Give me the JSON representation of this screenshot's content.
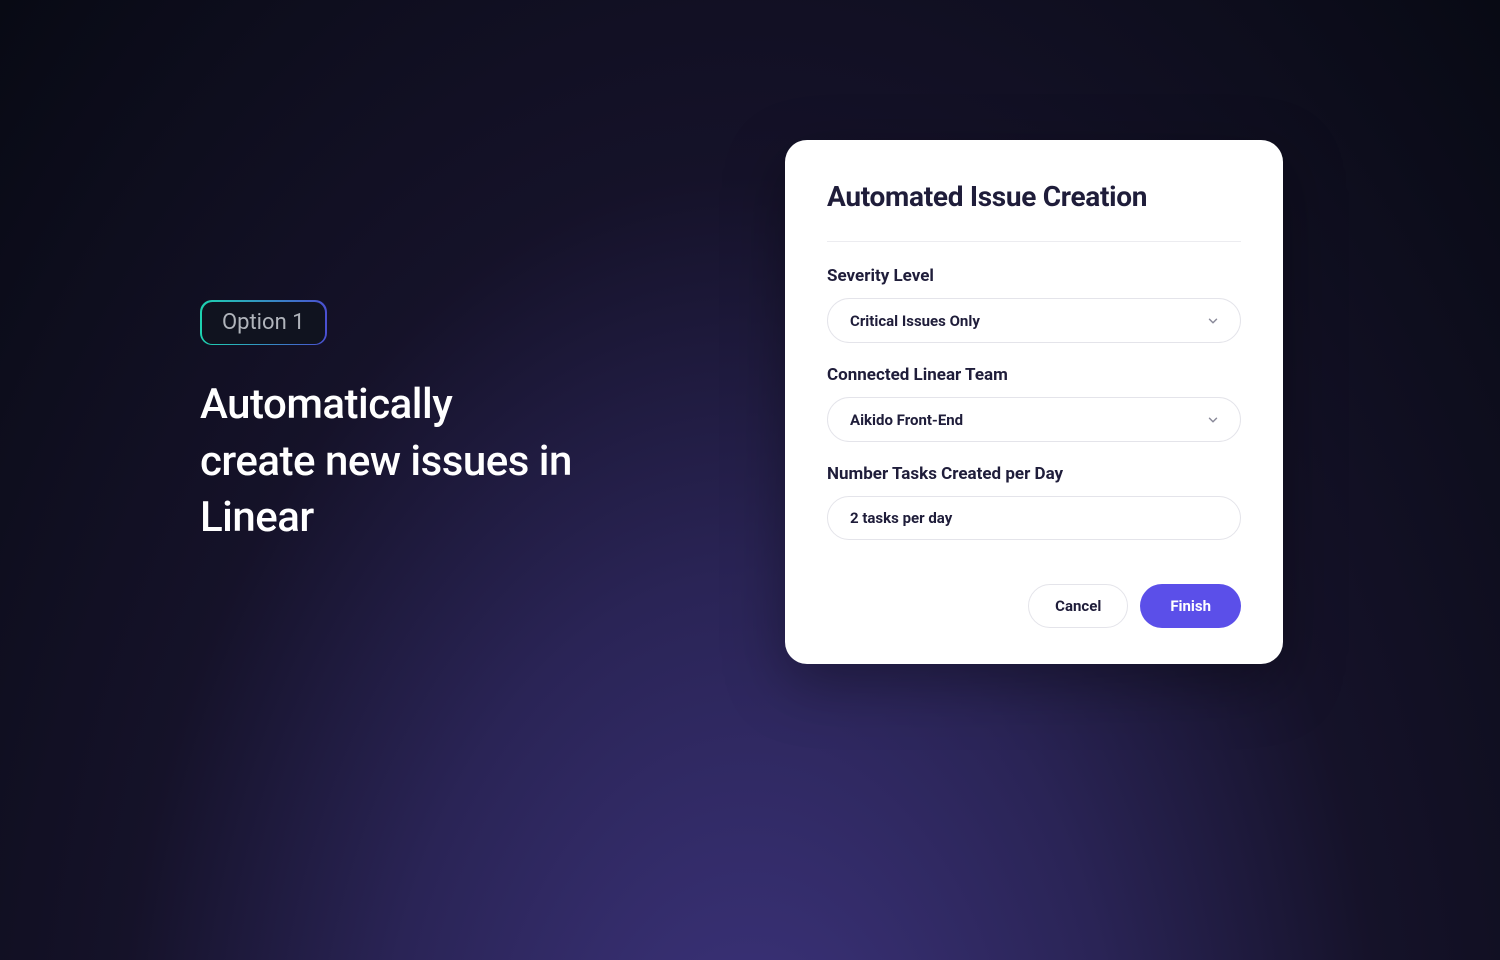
{
  "left": {
    "pill_label": "Option 1",
    "heading_line1": "Automatically",
    "heading_line2": "create new issues in",
    "heading_line3": "Linear"
  },
  "modal": {
    "title": "Automated Issue Creation",
    "fields": {
      "severity": {
        "label": "Severity Level",
        "value": "Critical Issues Only"
      },
      "team": {
        "label": "Connected Linear Team",
        "value": "Aikido Front-End"
      },
      "tasks": {
        "label": "Number Tasks Created per Day",
        "value": "2 tasks per day"
      }
    },
    "buttons": {
      "cancel": "Cancel",
      "finish": "Finish"
    }
  }
}
